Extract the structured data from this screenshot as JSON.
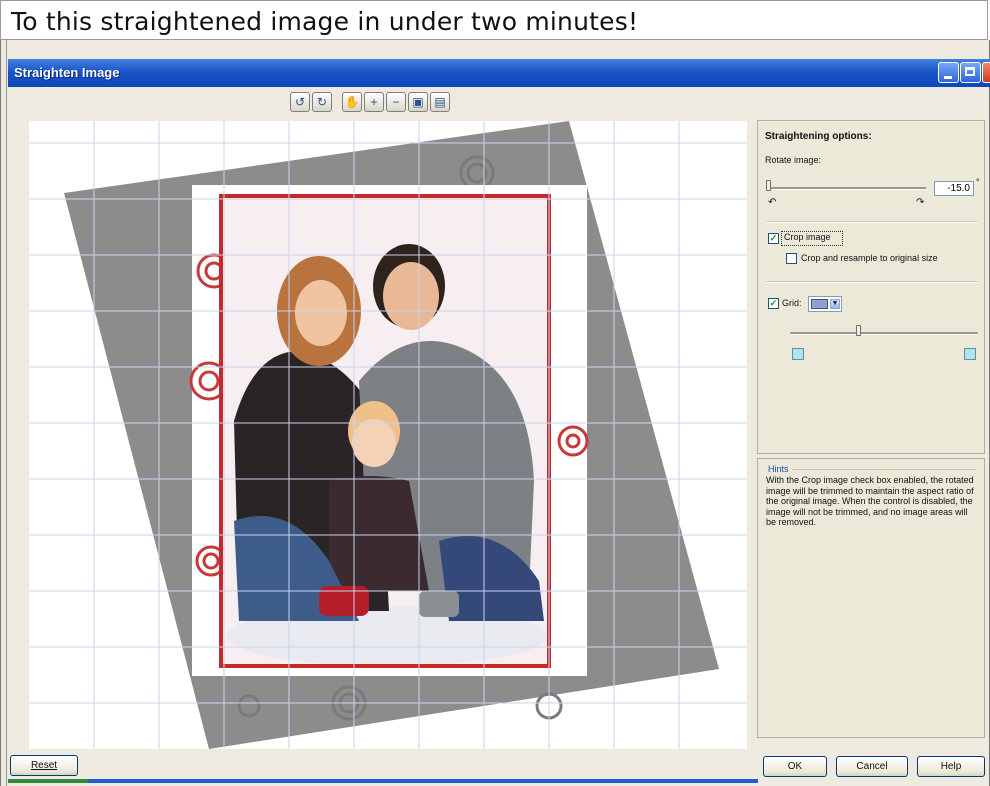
{
  "caption": "To this straightened image in under two minutes!",
  "window": {
    "title": "Straighten Image",
    "controls": [
      "minimize-icon",
      "maximize-icon",
      "close-icon"
    ]
  },
  "toolbar": {
    "buttons": [
      {
        "name": "rotate-left-icon",
        "glyph": "↺"
      },
      {
        "name": "rotate-right-icon",
        "glyph": "↻"
      },
      {
        "name": "pan-hand-icon",
        "glyph": "✋"
      },
      {
        "name": "zoom-in-icon",
        "glyph": "+"
      },
      {
        "name": "zoom-out-icon",
        "glyph": "−"
      },
      {
        "name": "fit-to-window-icon",
        "glyph": "▣"
      },
      {
        "name": "actual-size-icon",
        "glyph": "▤"
      }
    ]
  },
  "options": {
    "heading": "Straightening options:",
    "rotate_label": "Rotate image:",
    "rotate_value": "-15.0",
    "degree_symbol": "°",
    "rotate_fraction": 0.0,
    "crop_label": "Crop image",
    "crop_checked": true,
    "crop_resample_label": "Crop and resample to original size",
    "crop_resample_checked": false,
    "grid_label": "Grid:",
    "grid_checked": true,
    "grid_color": "#8d9fd6",
    "grid_size_fraction": 0.36,
    "swatch_color": "#aee6ef"
  },
  "hints": {
    "title": "Hints",
    "text": "With the Crop image check box enabled, the rotated image will be trimmed to maintain the aspect ratio of the original image. When the control is disabled, the image will not be trimmed, and no image areas will be removed."
  },
  "buttons": {
    "reset": "Reset",
    "ok": "OK",
    "cancel": "Cancel",
    "help": "Help"
  },
  "colors": {
    "titlebar": "#1b55c9",
    "dialog": "#ece9d8",
    "rotated_background": "#8c8c8c",
    "crop_border": "#c42a2a",
    "grid": "#c9d3ee"
  }
}
